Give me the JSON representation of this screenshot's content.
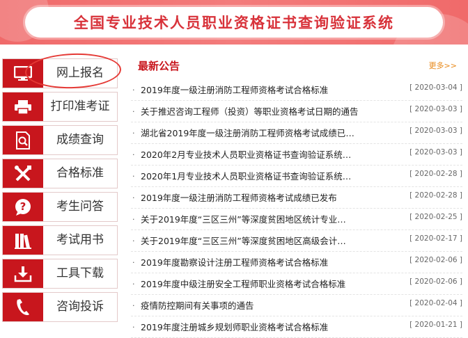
{
  "header": {
    "title": "全国专业技术人员职业资格证书查询验证系统"
  },
  "sidebar": {
    "items": [
      {
        "label": "网上报名",
        "icon": "monitor-icon"
      },
      {
        "label": "打印准考证",
        "icon": "printer-icon"
      },
      {
        "label": "成绩查询",
        "icon": "search-document-icon"
      },
      {
        "label": "合格标准",
        "icon": "tools-icon"
      },
      {
        "label": "考生问答",
        "icon": "question-icon"
      },
      {
        "label": "考试用书",
        "icon": "books-icon"
      },
      {
        "label": "工具下载",
        "icon": "download-icon"
      },
      {
        "label": "咨询投诉",
        "icon": "phone-icon"
      }
    ]
  },
  "news": {
    "title": "最新公告",
    "more": "更多>>",
    "items": [
      {
        "text": "2019年度一级注册消防工程师资格考试合格标准",
        "date": "[ 2020-03-04 ]"
      },
      {
        "text": "关于推迟咨询工程师（投资）等职业资格考试日期的通告",
        "date": "[ 2020-03-03 ]"
      },
      {
        "text": "湖北省2019年度一级注册消防工程师资格考试成绩已…",
        "date": "[ 2020-03-03 ]"
      },
      {
        "text": "2020年2月专业技术人员职业资格证书查询验证系统…",
        "date": "[ 2020-03-03 ]"
      },
      {
        "text": "2020年1月专业技术人员职业资格证书查询验证系统…",
        "date": "[ 2020-02-28 ]"
      },
      {
        "text": "2019年度一级注册消防工程师资格考试成绩已发布",
        "date": "[ 2020-02-28 ]"
      },
      {
        "text": "关于2019年度“三区三州”等深度贫困地区统计专业…",
        "date": "[ 2020-02-25 ]"
      },
      {
        "text": "关于2019年度“三区三州”等深度贫困地区高级会计…",
        "date": "[ 2020-02-17 ]"
      },
      {
        "text": "2019年度勘察设计注册工程师资格考试合格标准",
        "date": "[ 2020-02-06 ]"
      },
      {
        "text": "2019年度中级注册安全工程师职业资格考试合格标准",
        "date": "[ 2020-02-06 ]"
      },
      {
        "text": "疫情防控期间有关事项的通告",
        "date": "[ 2020-02-04 ]"
      },
      {
        "text": "2019年度注册城乡规划师职业资格考试合格标准",
        "date": "[ 2020-01-21 ]"
      }
    ]
  },
  "colors": {
    "brand_red": "#c8161d",
    "banner": "#f06a6a",
    "more": "#e8891a"
  }
}
